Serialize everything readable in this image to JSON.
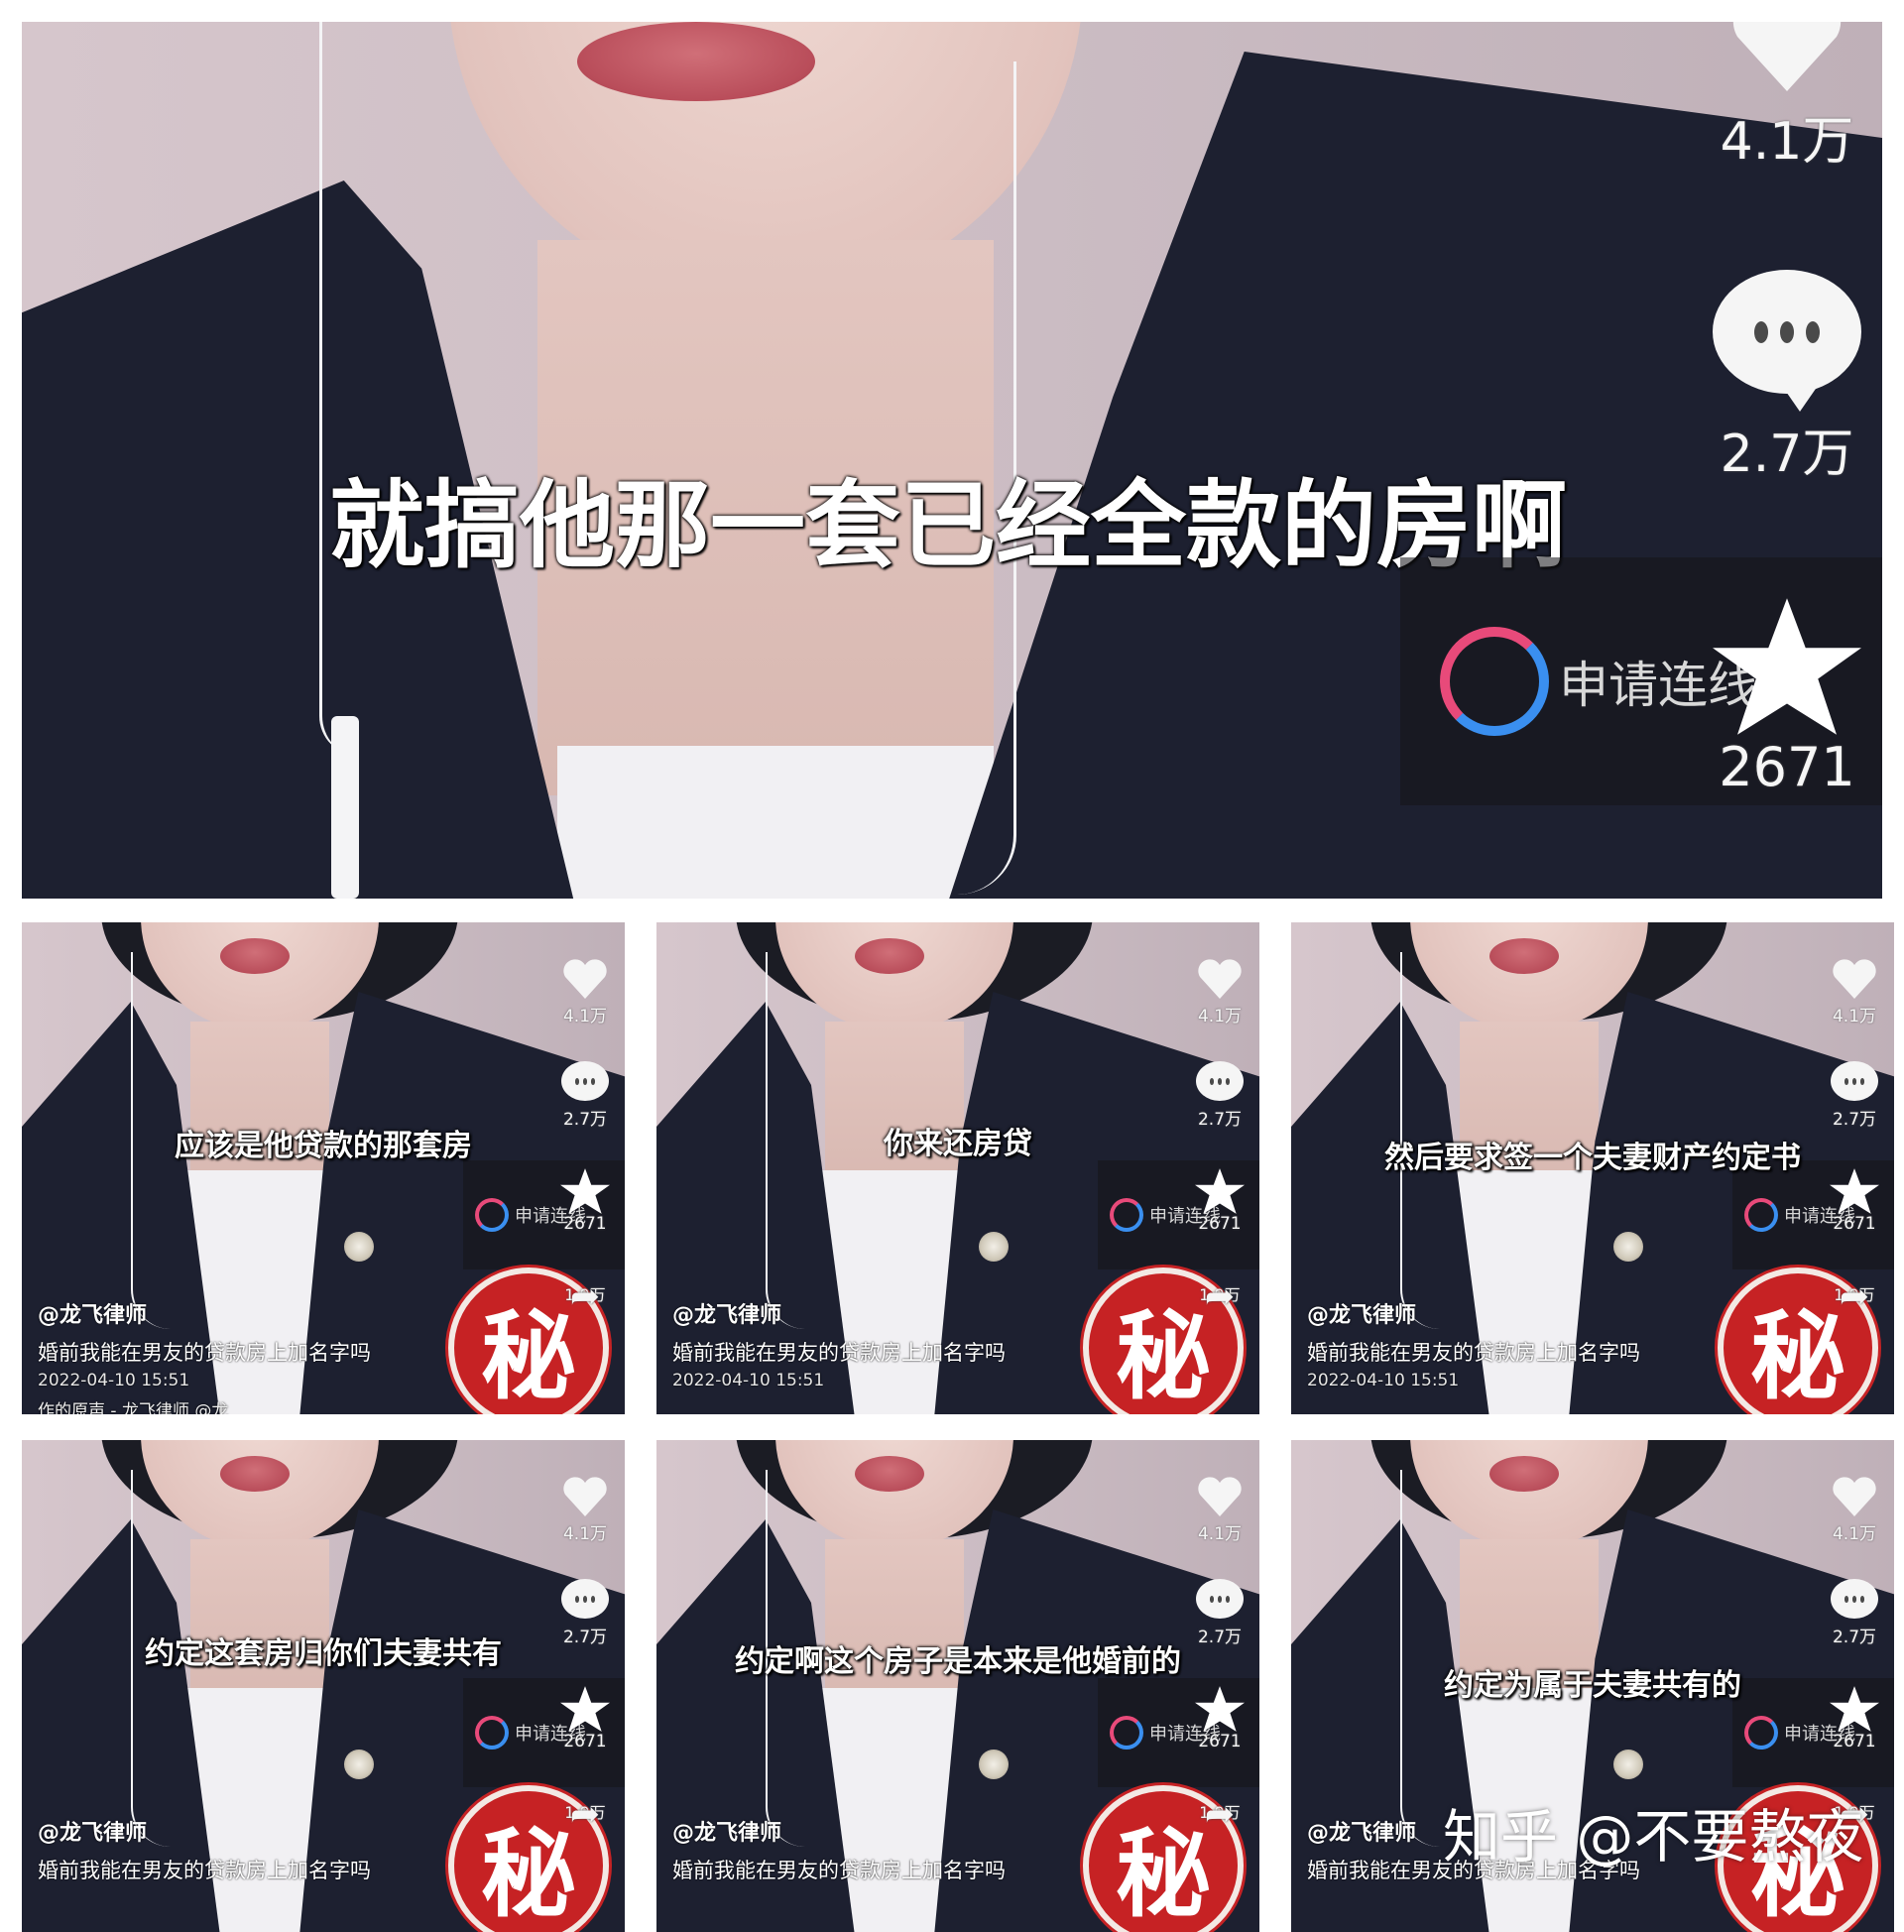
{
  "big": {
    "subtitle": "就搞他那一套已经全款的房啊",
    "likes": "4.1万",
    "comments": "2.7万",
    "connect": "申请连线",
    "favorites": "2671"
  },
  "tiles": [
    {
      "subtitle": "应该是他贷款的那套房",
      "likes": "4.1万",
      "comments": "2.7万",
      "connect": "申请连线",
      "favorites": "2671",
      "shares": "1.9万",
      "author": "@龙飞律师",
      "desc": "婚前我能在男友的贷款房上加名字吗",
      "date": "2022-04-10 15:51",
      "extra": "作的原声 - 龙飞律师 @龙"
    },
    {
      "subtitle": "你来还房贷",
      "likes": "4.1万",
      "comments": "2.7万",
      "connect": "申请连线",
      "favorites": "2671",
      "shares": "1.9万",
      "author": "@龙飞律师",
      "desc": "婚前我能在男友的贷款房上加名字吗",
      "date": "2022-04-10 15:51",
      "extra": ""
    },
    {
      "subtitle": "然后要求签一个夫妻财产约定书",
      "likes": "4.1万",
      "comments": "2.7万",
      "connect": "申请连线",
      "favorites": "2671",
      "shares": "1.9万",
      "author": "@龙飞律师",
      "desc": "婚前我能在男友的贷款房上加名字吗",
      "date": "2022-04-10 15:51",
      "extra": ""
    },
    {
      "subtitle": "约定这套房归你们夫妻共有",
      "likes": "4.1万",
      "comments": "2.7万",
      "connect": "申请连线",
      "favorites": "2671",
      "shares": "1.9万",
      "author": "@龙飞律师",
      "desc": "婚前我能在男友的贷款房上加名字吗",
      "date": "",
      "extra": ""
    },
    {
      "subtitle": "约定啊这个房子是本来是他婚前的",
      "likes": "4.1万",
      "comments": "2.7万",
      "connect": "申请连线",
      "favorites": "2671",
      "shares": "1.9万",
      "author": "@龙飞律师",
      "desc": "婚前我能在男友的贷款房上加名字吗",
      "date": "",
      "extra": ""
    },
    {
      "subtitle": "约定为属于夫妻共有的",
      "likes": "4.1万",
      "comments": "2.7万",
      "connect": "申请连线",
      "favorites": "2671",
      "shares": "1.9万",
      "author": "@龙飞律师",
      "desc": "婚前我能在男友的贷款房上加名字吗",
      "date": "",
      "extra": ""
    }
  ],
  "seal_char": "秘",
  "watermark": "知乎 @不要熬夜",
  "colors": {
    "jacket": "#1d2030",
    "lips": "#b94d5a",
    "seal": "#c62224",
    "connect_pink": "#e84a7a",
    "connect_blue": "#3a8ff0"
  }
}
